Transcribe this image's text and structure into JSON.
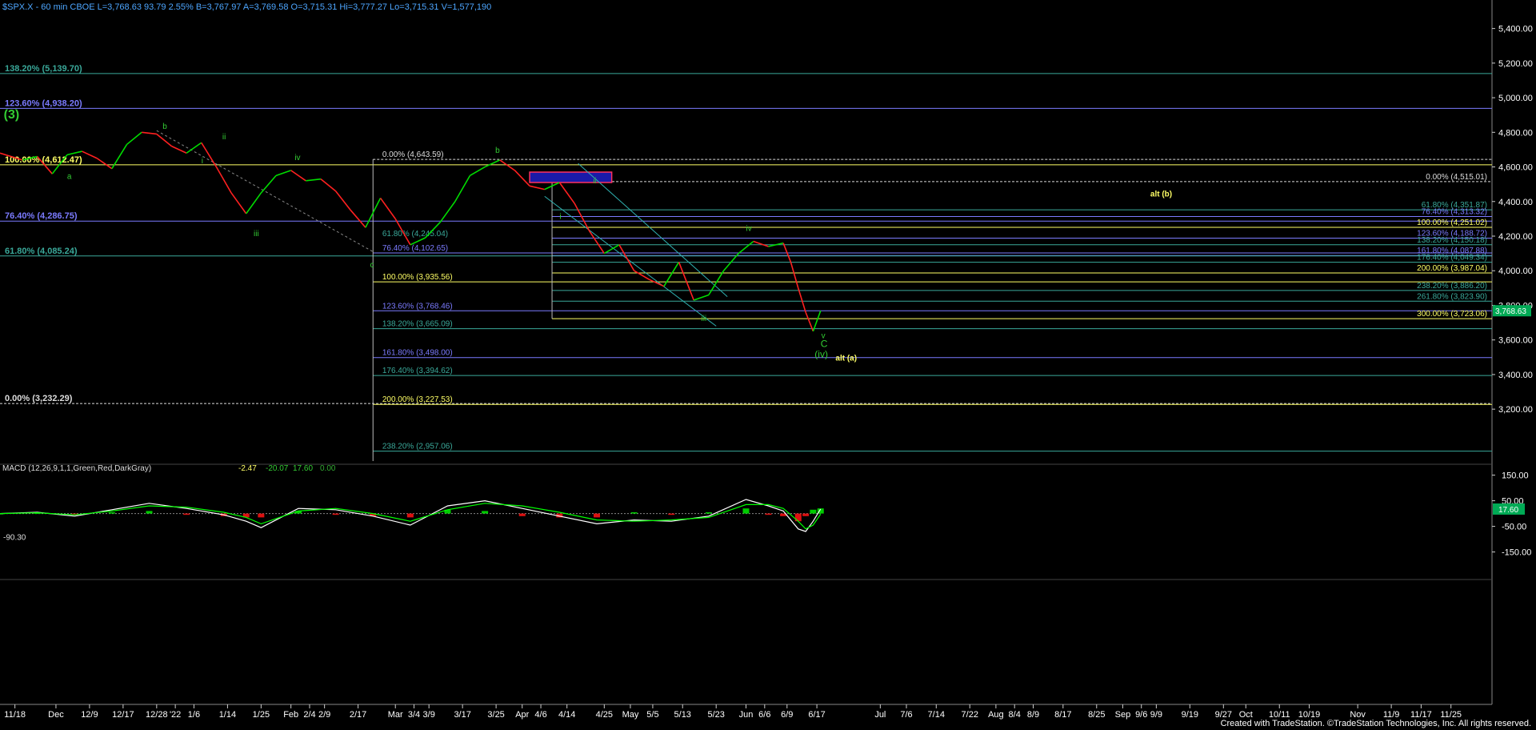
{
  "header": {
    "text": "$SPX.X - 60 min  CBOE  L=3,768.63  93.79  2.55%  B=3,767.97  A=3,769.58  O=3,715.31  Hi=3,777.27  Lo=3,715.31  V=1,577,190"
  },
  "footer": {
    "credit": "Created with TradeStation. ©TradeStation Technologies, Inc. All rights reserved."
  },
  "colors": {
    "background": "#000000",
    "price_up": "#00dd00",
    "price_down": "#ff2020",
    "yellow": "#ffff66",
    "blue_level": "#7b7bff",
    "teal_level": "#3aa99a",
    "white_level": "#dddddd",
    "green_label": "#33cc33",
    "axis_text": "#ffffff"
  },
  "chart_data": [
    {
      "type": "line",
      "name": "price",
      "ylim": [
        2900,
        5500
      ],
      "yticks": [
        3200,
        3400,
        3600,
        3800,
        4000,
        4200,
        4400,
        4600,
        4800,
        5000,
        5200,
        5400
      ],
      "ytick_labels": [
        "3,200.00",
        "3,400.00",
        "3,600.00",
        "3,800.00",
        "4,000.00",
        "4,200.00",
        "4,400.00",
        "4,600.00",
        "4,800.00",
        "5,000.00",
        "5,200.00",
        "5,400.00"
      ],
      "last_price_label": "3,768.63",
      "last_price": 3768.63,
      "x_index_range": [
        0,
        200
      ],
      "xticks": [
        {
          "i": 2,
          "label": "11/18"
        },
        {
          "i": 7.5,
          "label": "Dec"
        },
        {
          "i": 12,
          "label": "12/9"
        },
        {
          "i": 16.5,
          "label": "12/17"
        },
        {
          "i": 21,
          "label": "12/28"
        },
        {
          "i": 23.5,
          "label": "'22"
        },
        {
          "i": 26,
          "label": "1/6"
        },
        {
          "i": 30.5,
          "label": "1/14"
        },
        {
          "i": 35,
          "label": "1/25"
        },
        {
          "i": 39,
          "label": "Feb"
        },
        {
          "i": 41.5,
          "label": "2/4"
        },
        {
          "i": 43.5,
          "label": "2/9"
        },
        {
          "i": 48,
          "label": "2/17"
        },
        {
          "i": 53,
          "label": "Mar"
        },
        {
          "i": 55.5,
          "label": "3/4"
        },
        {
          "i": 57.5,
          "label": "3/9"
        },
        {
          "i": 62,
          "label": "3/17"
        },
        {
          "i": 66.5,
          "label": "3/25"
        },
        {
          "i": 70,
          "label": "Apr"
        },
        {
          "i": 72.5,
          "label": "4/6"
        },
        {
          "i": 76,
          "label": "4/14"
        },
        {
          "i": 81,
          "label": "4/25"
        },
        {
          "i": 84.5,
          "label": "May"
        },
        {
          "i": 87.5,
          "label": "5/5"
        },
        {
          "i": 91.5,
          "label": "5/13"
        },
        {
          "i": 96,
          "label": "5/23"
        },
        {
          "i": 100,
          "label": "Jun"
        },
        {
          "i": 102.5,
          "label": "6/6"
        },
        {
          "i": 105.5,
          "label": "6/9"
        },
        {
          "i": 109.5,
          "label": "6/17"
        },
        {
          "i": 118,
          "label": "Jul"
        },
        {
          "i": 121.5,
          "label": "7/6"
        },
        {
          "i": 125.5,
          "label": "7/14"
        },
        {
          "i": 130,
          "label": "7/22"
        },
        {
          "i": 133.5,
          "label": "Aug"
        },
        {
          "i": 136,
          "label": "8/4"
        },
        {
          "i": 138.5,
          "label": "8/9"
        },
        {
          "i": 142.5,
          "label": "8/17"
        },
        {
          "i": 147,
          "label": "8/25"
        },
        {
          "i": 150.5,
          "label": "Sep"
        },
        {
          "i": 153,
          "label": "9/6"
        },
        {
          "i": 155,
          "label": "9/9"
        },
        {
          "i": 159.5,
          "label": "9/19"
        },
        {
          "i": 164,
          "label": "9/27"
        },
        {
          "i": 167,
          "label": "Oct"
        },
        {
          "i": 171.5,
          "label": "10/11"
        },
        {
          "i": 175.5,
          "label": "10/19"
        },
        {
          "i": 182,
          "label": "Nov"
        },
        {
          "i": 186.5,
          "label": "11/9"
        },
        {
          "i": 190.5,
          "label": "11/17"
        },
        {
          "i": 194.5,
          "label": "11/25"
        }
      ],
      "x": [
        0,
        3,
        5,
        7,
        9,
        11,
        13,
        15,
        17,
        19,
        21,
        23,
        25,
        27,
        29,
        31,
        33,
        35,
        37,
        39,
        41,
        43,
        45,
        47,
        49,
        51,
        53,
        55,
        57,
        59,
        61,
        63,
        65,
        67,
        69,
        71,
        73,
        75,
        77,
        79,
        81,
        83,
        85,
        87,
        89,
        91,
        93,
        95,
        97,
        99,
        101,
        103,
        105,
        106,
        107,
        108,
        109,
        110
      ],
      "y": [
        4680,
        4640,
        4660,
        4560,
        4670,
        4690,
        4650,
        4590,
        4730,
        4800,
        4790,
        4720,
        4680,
        4740,
        4600,
        4450,
        4330,
        4450,
        4550,
        4580,
        4520,
        4530,
        4460,
        4350,
        4250,
        4420,
        4300,
        4150,
        4190,
        4280,
        4400,
        4550,
        4600,
        4640,
        4580,
        4490,
        4470,
        4510,
        4390,
        4230,
        4100,
        4150,
        4000,
        3950,
        3910,
        4050,
        3830,
        3860,
        4000,
        4100,
        4170,
        4140,
        4160,
        4050,
        3900,
        3760,
        3650,
        3768.63
      ]
    },
    {
      "type": "line",
      "name": "MACD (12,26,9,1,1,Green,Red,DarkGray)",
      "label": "MACD (12,26,9,1,1,Green,Red,DarkGray)",
      "readout": [
        "-2.47",
        "-20.07",
        "17.60",
        "0.00"
      ],
      "ylim": [
        -170,
        180
      ],
      "yticks": [
        150,
        50,
        -50,
        -150
      ],
      "ytick_labels": [
        "150.00",
        "50.00",
        "-50.00",
        "-150.00"
      ],
      "min_label": "-90.30",
      "last_label": "17.60",
      "last_value": 17.6,
      "x": [
        0,
        5,
        10,
        15,
        20,
        25,
        30,
        33,
        35,
        40,
        45,
        50,
        55,
        60,
        65,
        70,
        75,
        80,
        85,
        90,
        95,
        100,
        103,
        105,
        107,
        108,
        109,
        110
      ],
      "macd": [
        0,
        5,
        -10,
        15,
        40,
        20,
        -5,
        -30,
        -55,
        20,
        15,
        -10,
        -45,
        30,
        50,
        20,
        -10,
        -40,
        -25,
        -30,
        -10,
        55,
        30,
        10,
        -60,
        -70,
        -30,
        17.6
      ],
      "signal": [
        0,
        3,
        -5,
        10,
        30,
        25,
        5,
        -15,
        -40,
        10,
        20,
        0,
        -30,
        15,
        40,
        30,
        5,
        -25,
        -30,
        -25,
        -15,
        35,
        35,
        20,
        -30,
        -60,
        -45,
        -2.47
      ]
    }
  ],
  "fib_levels": [
    {
      "value": 5139.7,
      "label": "138.20% (5,139.70)",
      "color": "teal",
      "dash": false,
      "x0": 0,
      "lx": 0,
      "align": "left",
      "bold": true,
      "size": 11
    },
    {
      "value": 4938.2,
      "label": "123.60% (4,938.20)",
      "color": "blue",
      "dash": false,
      "x0": 0,
      "lx": 0,
      "align": "left",
      "bold": true,
      "size": 11
    },
    {
      "value": 4643.59,
      "label": "0.00% (4,643.59)",
      "color": "white",
      "dash": true,
      "x0": 50,
      "lx": 50.6,
      "align": "left",
      "bold": false,
      "size": 10
    },
    {
      "value": 4612.47,
      "label": "100.00% (4,612.47)",
      "color": "yellow",
      "dash": false,
      "x0": 0,
      "lx": 0,
      "align": "left",
      "bold": true,
      "size": 11
    },
    {
      "value": 4515.01,
      "label": "0.00% (4,515.01)",
      "color": "white",
      "dash": true,
      "x0": 74,
      "lx": 194,
      "align": "right",
      "bold": false,
      "size": 10
    },
    {
      "value": 4351.87,
      "label": "61.80% (4,351.87)",
      "color": "teal",
      "dash": false,
      "x0": 74,
      "lx": 194,
      "align": "right",
      "bold": false,
      "size": 10
    },
    {
      "value": 4313.32,
      "label": "76.40% (4,313.32)",
      "color": "blue",
      "dash": false,
      "x0": 74,
      "lx": 194,
      "align": "right",
      "bold": false,
      "size": 10
    },
    {
      "value": 4286.75,
      "label": "76.40% (4,286.75)",
      "color": "blue",
      "dash": false,
      "x0": 0,
      "lx": 0,
      "align": "left",
      "bold": true,
      "size": 11
    },
    {
      "value": 4251.02,
      "label": "100.00% (4,251.02)",
      "color": "yellow",
      "dash": false,
      "x0": 74,
      "lx": 194,
      "align": "right",
      "bold": false,
      "size": 10
    },
    {
      "value": 4188.72,
      "label": "123.60% (4,188.72)",
      "color": "blue",
      "dash": false,
      "x0": 74,
      "lx": 194,
      "align": "right",
      "bold": false,
      "size": 10
    },
    {
      "value": 4150.18,
      "label": "138.20% (4,150.18)",
      "color": "teal",
      "dash": false,
      "x0": 74,
      "lx": 194,
      "align": "right",
      "bold": false,
      "size": 10
    },
    {
      "value": 4102.65,
      "label": "76.40% (4,102.65)",
      "color": "blue",
      "dash": false,
      "x0": 50,
      "lx": 50.6,
      "align": "left",
      "bold": false,
      "size": 10
    },
    {
      "value": 4087.88,
      "label": "161.80% (4,087.88)",
      "color": "blue",
      "dash": false,
      "x0": 74,
      "lx": 194,
      "align": "right",
      "bold": false,
      "size": 10
    },
    {
      "value": 4085.24,
      "label": "61.80% (4,085.24)",
      "color": "teal",
      "dash": false,
      "x0": 0,
      "lx": 0,
      "align": "left",
      "bold": true,
      "size": 11
    },
    {
      "value": 4049.34,
      "label": "176.40% (4,049.34)",
      "color": "teal",
      "dash": false,
      "x0": 74,
      "lx": 194,
      "align": "right",
      "bold": false,
      "size": 10
    },
    {
      "value": 3987.04,
      "label": "200.00% (3,987.04)",
      "color": "yellow",
      "dash": false,
      "x0": 74,
      "lx": 194,
      "align": "right",
      "bold": false,
      "size": 10
    },
    {
      "value": 3935.56,
      "label": "100.00% (3,935.56)",
      "color": "yellow",
      "dash": false,
      "x0": 50,
      "lx": 50.6,
      "align": "left",
      "bold": false,
      "size": 10
    },
    {
      "value": 3886.2,
      "label": "238.20% (3,886.20)",
      "color": "teal",
      "dash": false,
      "x0": 74,
      "lx": 194,
      "align": "right",
      "bold": false,
      "size": 10
    },
    {
      "value": 3823.9,
      "label": "261.80% (3,823.90)",
      "color": "teal",
      "dash": false,
      "x0": 74,
      "lx": 194,
      "align": "right",
      "bold": false,
      "size": 10
    },
    {
      "value": 3768.46,
      "label": "123.60% (3,768.46)",
      "color": "blue",
      "dash": false,
      "x0": 50,
      "lx": 50.6,
      "align": "left",
      "bold": false,
      "size": 10
    },
    {
      "value": 3723.06,
      "label": "300.00% (3,723.06)",
      "color": "yellow",
      "dash": false,
      "x0": 74,
      "lx": 194,
      "align": "right",
      "bold": false,
      "size": 10
    },
    {
      "value": 3665.09,
      "label": "138.20% (3,665.09)",
      "color": "teal",
      "dash": false,
      "x0": 50,
      "lx": 50.6,
      "align": "left",
      "bold": false,
      "size": 10
    },
    {
      "value": 3498.0,
      "label": "161.80% (3,498.00)",
      "color": "blue",
      "dash": false,
      "x0": 50,
      "lx": 50.6,
      "align": "left",
      "bold": false,
      "size": 10
    },
    {
      "value": 3394.62,
      "label": "176.40% (3,394.62)",
      "color": "teal",
      "dash": false,
      "x0": 50,
      "lx": 50.6,
      "align": "left",
      "bold": false,
      "size": 10
    },
    {
      "value": 3232.29,
      "label": "0.00% (3,232.29)",
      "color": "white",
      "dash": true,
      "x0": 0,
      "lx": 0,
      "align": "left",
      "bold": true,
      "size": 11
    },
    {
      "value": 3227.53,
      "label": "200.00% (3,227.53)",
      "color": "yellow",
      "dash": false,
      "x0": 50,
      "lx": 50.6,
      "align": "left",
      "bold": false,
      "size": 10
    },
    {
      "value": 2957.06,
      "label": "238.20% (2,957.06)",
      "color": "teal",
      "dash": false,
      "x0": 50,
      "lx": 50.6,
      "align": "left",
      "bold": false,
      "size": 10
    }
  ],
  "inline_labels": [
    {
      "text": "61.80% (4,245.04)",
      "x": 50.6,
      "y": 4200,
      "color": "teal",
      "size": 10
    }
  ],
  "wave_labels": [
    {
      "text": "(3)",
      "x": 0.5,
      "y": 4880,
      "color": "green",
      "size": 16,
      "bold": true
    },
    {
      "text": "a",
      "x": 9,
      "y": 4530,
      "color": "green",
      "size": 10
    },
    {
      "text": "b",
      "x": 21.8,
      "y": 4820,
      "color": "green",
      "size": 10
    },
    {
      "text": "i",
      "x": 27,
      "y": 4620,
      "color": "green",
      "size": 10
    },
    {
      "text": "ii",
      "x": 29.8,
      "y": 4760,
      "color": "green",
      "size": 10
    },
    {
      "text": "iii",
      "x": 34,
      "y": 4200,
      "color": "green",
      "size": 10
    },
    {
      "text": "iv",
      "x": 39.5,
      "y": 4640,
      "color": "green",
      "size": 10
    },
    {
      "text": "c",
      "x": 49.6,
      "y": 4020,
      "color": "green",
      "size": 10
    },
    {
      "text": "b",
      "x": 66.4,
      "y": 4680,
      "color": "green",
      "size": 10
    },
    {
      "text": "ii",
      "x": 79.5,
      "y": 4505,
      "color": "green",
      "size": 10
    },
    {
      "text": "i",
      "x": 75,
      "y": 4300,
      "color": "green",
      "size": 10
    },
    {
      "text": "iii",
      "x": 94,
      "y": 3710,
      "color": "green",
      "size": 10
    },
    {
      "text": "iv",
      "x": 100,
      "y": 4230,
      "color": "green",
      "size": 10
    },
    {
      "text": "v",
      "x": 110.1,
      "y": 3610,
      "color": "green",
      "size": 10
    },
    {
      "text": "C",
      "x": 110,
      "y": 3560,
      "color": "green",
      "size": 12
    },
    {
      "text": "(iv)",
      "x": 109.2,
      "y": 3500,
      "color": "green",
      "size": 12
    },
    {
      "text": "alt (a)",
      "x": 112,
      "y": 3480,
      "color": "yellow",
      "size": 10,
      "bold": true
    },
    {
      "text": "alt (b)",
      "x": 154.2,
      "y": 4430,
      "color": "yellow",
      "size": 10,
      "bold": true
    }
  ]
}
